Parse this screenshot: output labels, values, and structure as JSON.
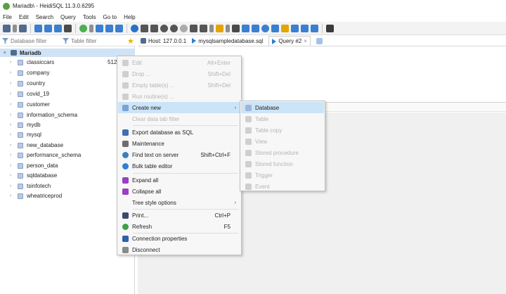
{
  "window": {
    "title": "Mariadb\\ - HeidiSQL 11.3.0.6295"
  },
  "menu": [
    "File",
    "Edit",
    "Search",
    "Query",
    "Tools",
    "Go to",
    "Help"
  ],
  "filters": {
    "database": "Database filter",
    "table": "Table filter"
  },
  "tabs": {
    "host": "Host: 127.0.0.1",
    "file": "mysqlsampledatabase.sql",
    "query": "Query #2"
  },
  "tree": {
    "root": "Mariadb",
    "items": [
      {
        "name": "classiccars",
        "size": "512"
      },
      {
        "name": "company"
      },
      {
        "name": "country"
      },
      {
        "name": "covid_19"
      },
      {
        "name": "customer"
      },
      {
        "name": "information_schema"
      },
      {
        "name": "mydb"
      },
      {
        "name": "mysql"
      },
      {
        "name": "new_database"
      },
      {
        "name": "performance_schema"
      },
      {
        "name": "person_data"
      },
      {
        "name": "sqldatabase"
      },
      {
        "name": "tsinfotech"
      },
      {
        "name": "wheatriceprod"
      }
    ]
  },
  "context_menu": {
    "items": [
      {
        "label": "Edit",
        "shortcut": "Alt+Enter",
        "disabled": true,
        "icon": "edit-icon",
        "color": "#cfcfcf"
      },
      {
        "label": "Drop ...",
        "shortcut": "Shift+Del",
        "disabled": true,
        "icon": "drop-icon",
        "color": "#cfcfcf"
      },
      {
        "label": "Empty table(s) ...",
        "shortcut": "Shift+Del",
        "disabled": true,
        "icon": "empty-icon",
        "color": "#cfcfcf"
      },
      {
        "label": "Run routine(s) ...",
        "shortcut": "",
        "disabled": true,
        "icon": "run-icon",
        "color": "#cfcfcf"
      },
      {
        "label": "Create new",
        "shortcut": "",
        "submenu": true,
        "highlighted": true,
        "icon": "create-icon",
        "color": "#7aa3d6"
      },
      {
        "label": "Clear data tab filter",
        "shortcut": "",
        "disabled": true,
        "icon": "",
        "color": ""
      },
      {
        "label": "Export database as SQL",
        "shortcut": "",
        "icon": "export-icon",
        "color": "#3d6fb5"
      },
      {
        "label": "Maintenance",
        "shortcut": "",
        "icon": "wrench-icon",
        "color": "#6d6d6d"
      },
      {
        "label": "Find text on server",
        "shortcut": "Shift+Ctrl+F",
        "icon": "search-icon",
        "color": "#3a7fc2"
      },
      {
        "label": "Bulk table editor",
        "shortcut": "",
        "icon": "bulk-editor-icon",
        "color": "#2f7fd6"
      },
      {
        "label": "Expand all",
        "shortcut": "",
        "icon": "expand-icon",
        "color": "#9a3fc2"
      },
      {
        "label": "Collapse all",
        "shortcut": "",
        "icon": "collapse-icon",
        "color": "#9a3fc2"
      },
      {
        "label": "Tree style options",
        "shortcut": "",
        "submenu": true,
        "icon": "",
        "color": ""
      },
      {
        "label": "Print...",
        "shortcut": "Ctrl+P",
        "icon": "printer-icon",
        "color": "#3a4a6b"
      },
      {
        "label": "Refresh",
        "shortcut": "F5",
        "icon": "refresh-icon",
        "color": "#3aa24a"
      },
      {
        "label": "Connection properties",
        "shortcut": "",
        "icon": "properties-icon",
        "color": "#2f5fb0"
      },
      {
        "label": "Disconnect",
        "shortcut": "",
        "icon": "disconnect-icon",
        "color": "#8a8a8a"
      }
    ]
  },
  "submenu": {
    "items": [
      {
        "label": "Database",
        "disabled": false,
        "highlighted": true,
        "icon": "database-icon",
        "color": "#9fb6d8"
      },
      {
        "label": "Table",
        "disabled": true,
        "icon": "table-icon"
      },
      {
        "label": "Table copy",
        "disabled": true,
        "icon": "table-copy-icon"
      },
      {
        "label": "View",
        "disabled": true,
        "icon": "view-icon"
      },
      {
        "label": "Stored procedure",
        "disabled": true,
        "icon": "procedure-icon"
      },
      {
        "label": "Stored function",
        "disabled": true,
        "icon": "function-icon"
      },
      {
        "label": "Trigger",
        "disabled": true,
        "icon": "trigger-icon"
      },
      {
        "label": "Event",
        "disabled": true,
        "icon": "event-icon"
      }
    ]
  }
}
